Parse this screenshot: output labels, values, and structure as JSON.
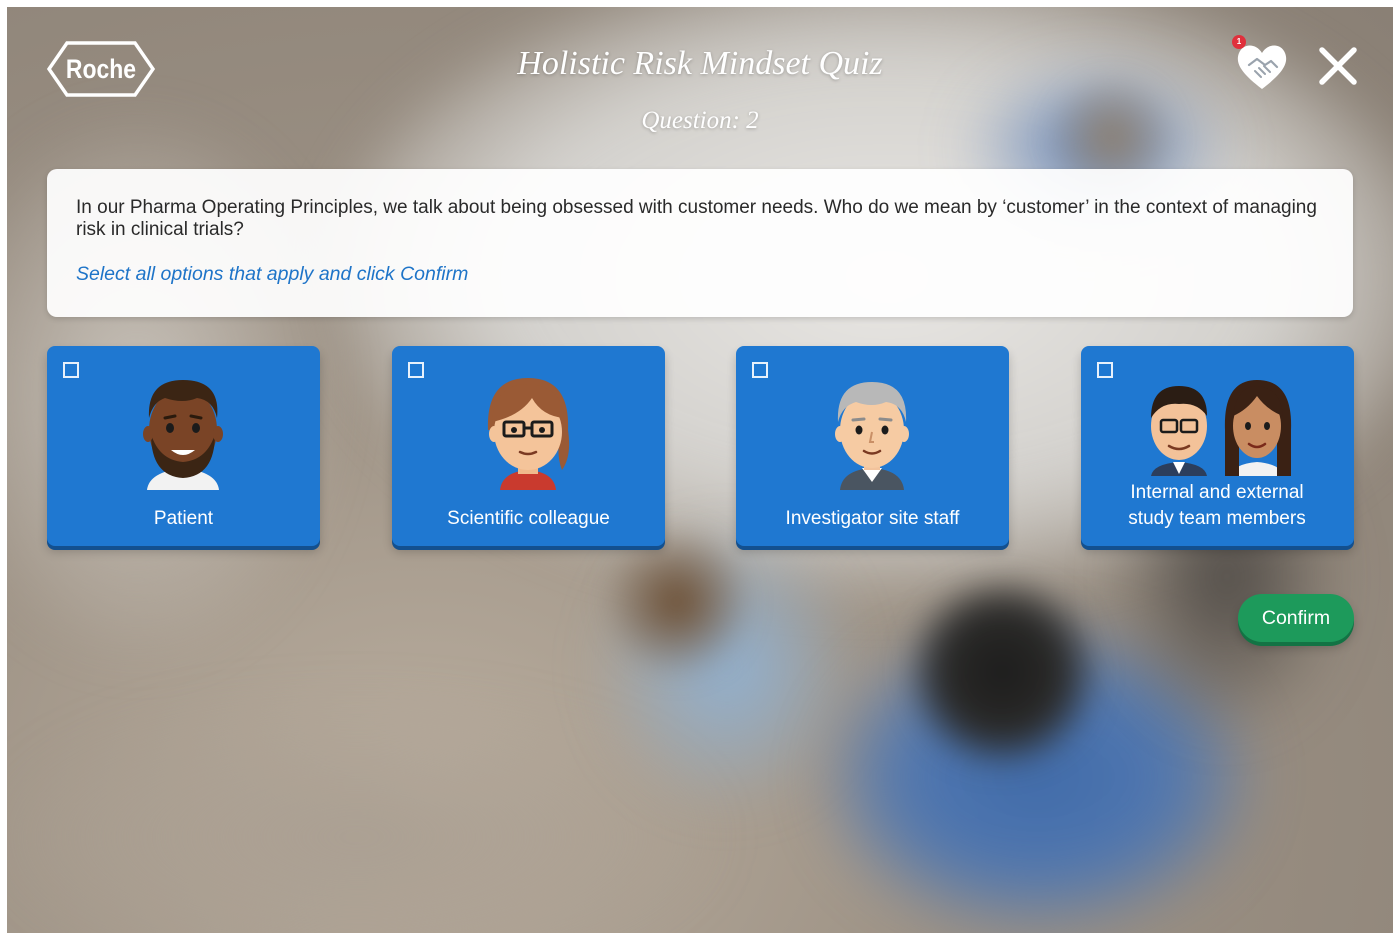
{
  "header": {
    "logo_text": "Roche",
    "title": "Holistic Risk Mindset Quiz",
    "question_label": "Question: 2",
    "heart_badge_count": "1",
    "heart_icon": "heart-handshake-icon",
    "close_icon": "close-icon"
  },
  "question": {
    "text": "In our Pharma Operating Principles, we talk about being obsessed with customer needs. Who do we mean by ‘customer’ in the context of managing risk in clinical trials?",
    "instruction": "Select all options that apply and click Confirm"
  },
  "options": [
    {
      "label": "Patient",
      "icon": "patient-avatar-icon",
      "checked": false
    },
    {
      "label": "Scientific colleague",
      "icon": "scientist-avatar-icon",
      "checked": false
    },
    {
      "label": "Investigator site staff",
      "icon": "investigator-avatar-icon",
      "checked": false
    },
    {
      "label": "Internal and external study team members",
      "icon": "team-avatar-icon",
      "checked": false
    }
  ],
  "confirm_label": "Confirm",
  "colors": {
    "option_blue": "#1f78d1",
    "confirm_green": "#1d9a5b",
    "instruction_blue": "#1e74c8",
    "badge_red": "#e0303c"
  }
}
